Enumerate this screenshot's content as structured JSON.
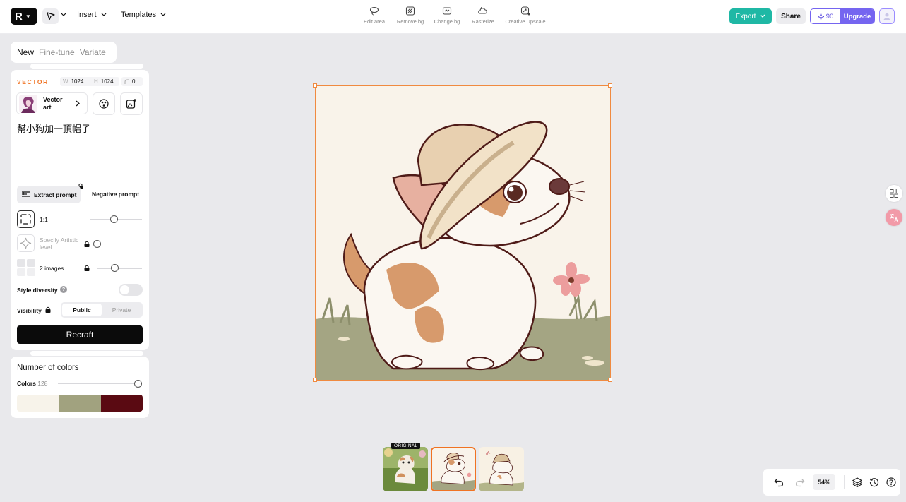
{
  "topbar": {
    "logo_mark": "R",
    "insert_label": "Insert",
    "templates_label": "Templates",
    "tools": [
      {
        "label": "Edit area",
        "icon": "lasso-icon"
      },
      {
        "label": "Remove bg",
        "icon": "remove-bg-icon"
      },
      {
        "label": "Change bg",
        "icon": "change-bg-icon"
      },
      {
        "label": "Rasterize",
        "icon": "rasterize-icon"
      },
      {
        "label": "Creative Upscale",
        "icon": "upscale-icon"
      }
    ],
    "export_label": "Export",
    "share_label": "Share",
    "credits": "90",
    "upgrade_label": "Upgrade"
  },
  "mode_tabs": [
    {
      "label": "New",
      "active": true
    },
    {
      "label": "Fine-tune",
      "active": false
    },
    {
      "label": "Variate",
      "active": false
    }
  ],
  "generator": {
    "type_label": "VECTOR",
    "width_key": "W",
    "width": "1024",
    "height_key": "H",
    "height": "1024",
    "radius": "0",
    "style_name": "Vector art",
    "prompt": "幫小狗加一頂帽子",
    "extract_prompt_label": "Extract prompt",
    "negative_prompt_label": "Negative prompt",
    "aspect_label": "1:1",
    "artistic_label": "Specify Artistic level",
    "images_label": "2 images",
    "style_diversity_label": "Style diversity",
    "style_diversity_on": false,
    "visibility_label": "Visibility",
    "visibility_options": [
      "Public",
      "Private"
    ],
    "visibility_selected": "Public",
    "recraft_label": "Recraft"
  },
  "colors_panel": {
    "title": "Number of colors",
    "colors_label": "Colors",
    "colors_value": "128",
    "palette": [
      "#f7f3ea",
      "#a1a27f",
      "#5a0a12"
    ]
  },
  "variants": {
    "original_tag": "ORIGINAL",
    "selected_index": 1
  },
  "bottom_bar": {
    "zoom": "54%"
  },
  "accent_colors": {
    "orange": "#f07323",
    "teal": "#1fb8a5",
    "purple": "#7565f0"
  }
}
